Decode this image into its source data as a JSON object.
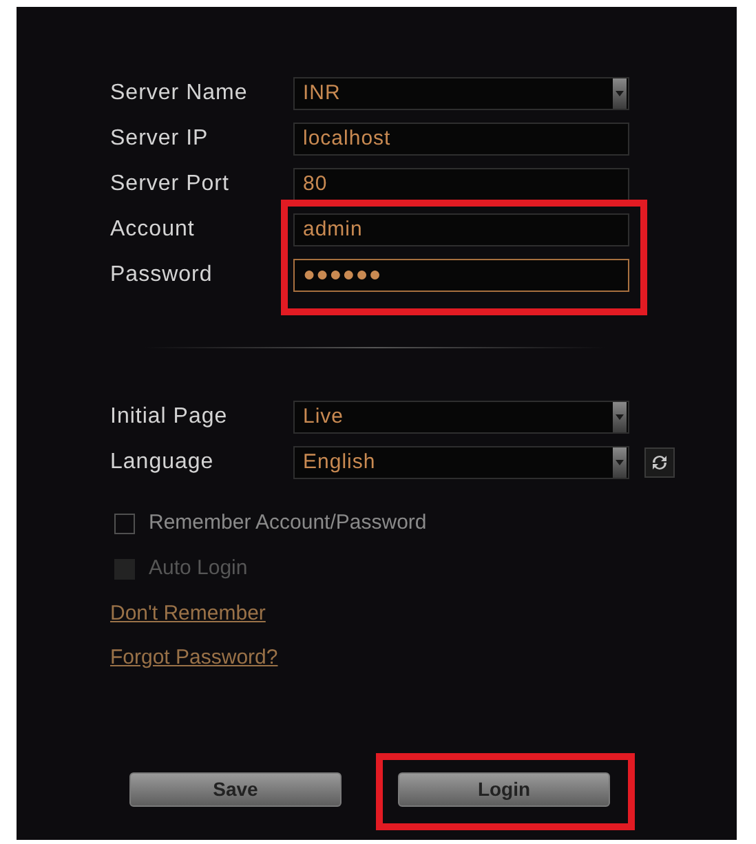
{
  "server_fields": [
    {
      "kind": "select",
      "label": "Server Name",
      "value": "INR",
      "focused": false
    },
    {
      "kind": "text",
      "label": "Server IP",
      "value": "localhost",
      "focused": false
    },
    {
      "kind": "text",
      "label": "Server Port",
      "value": "80",
      "focused": false
    }
  ],
  "credentials": {
    "highlighted": true,
    "fields": [
      {
        "kind": "text",
        "label": "Account",
        "value": "admin",
        "focused": false
      },
      {
        "kind": "text",
        "label": "Password",
        "value": "●●●●●●",
        "focused": true
      }
    ]
  },
  "preferences": [
    {
      "kind": "select",
      "label": "Initial Page",
      "value": "Live",
      "focused": false
    },
    {
      "kind": "combo",
      "label": "Language",
      "value": "English",
      "focused": false
    }
  ],
  "checkboxes": [
    {
      "label": "Remember Account/Password",
      "checked": false,
      "disabled": false
    },
    {
      "label": "Auto Login",
      "checked": false,
      "disabled": true
    }
  ],
  "links": [
    "Don't Remember",
    "Forgot Password?"
  ],
  "buttons": [
    {
      "label": "Save",
      "highlighted": false
    },
    {
      "label": "Login",
      "highlighted": true
    }
  ]
}
